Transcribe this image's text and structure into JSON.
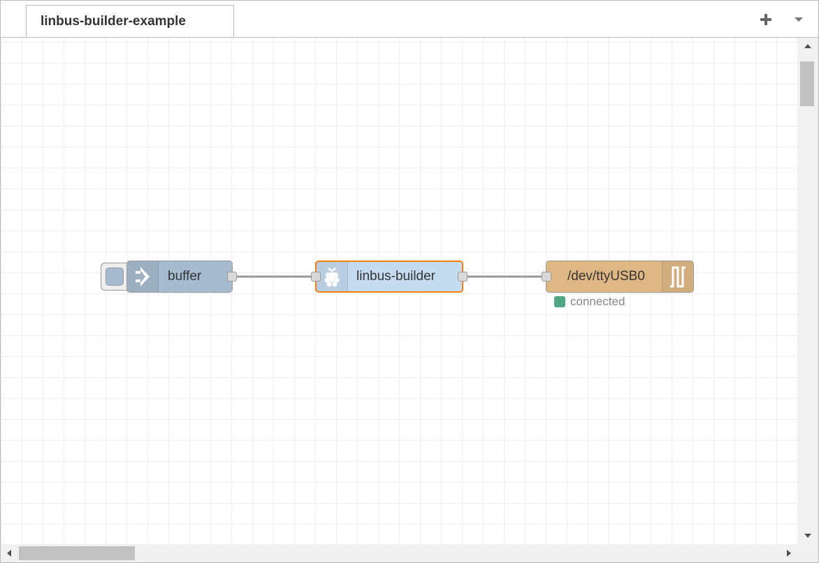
{
  "tabs": [
    {
      "label": "linbus-builder-example"
    }
  ],
  "toolbar": {
    "add_icon": "plus-icon",
    "menu_icon": "caret-down-icon"
  },
  "nodes": [
    {
      "id": "buffer",
      "label": "buffer",
      "icon": "arrow-right-icon",
      "color": "#a6bbcf"
    },
    {
      "id": "linbus",
      "label": "linbus-builder",
      "icon": "raspberry-pi-icon",
      "color": "#c5dcf0",
      "selected_color": "#ff7f0e"
    },
    {
      "id": "serial",
      "label": "/dev/ttyUSB0",
      "icon": "serial-wave-icon",
      "color": "#dfb784"
    }
  ],
  "status": {
    "text": "connected",
    "color": "#4fa883"
  }
}
